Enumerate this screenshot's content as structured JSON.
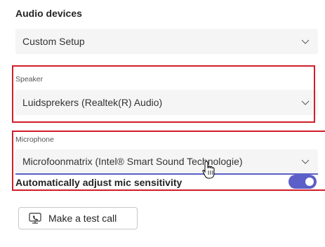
{
  "audio": {
    "section_title": "Audio devices",
    "device_setup": {
      "value": "Custom Setup",
      "icon": "chevron-down-icon"
    },
    "speaker": {
      "label": "Speaker",
      "value": "Luidsprekers (Realtek(R) Audio)",
      "icon": "chevron-down-icon"
    },
    "microphone": {
      "label": "Microphone",
      "value": "Microfoonmatrix (Intel® Smart Sound Technologie)",
      "icon": "chevron-down-icon"
    },
    "auto_adjust": {
      "label": "Automatically adjust mic sensitivity",
      "enabled": true
    },
    "test_call": {
      "label": "Make a test call",
      "icon": "test-call-icon"
    }
  },
  "colors": {
    "accent": "#5b5fc7",
    "highlight": "#d11d2a",
    "dropdown_bg": "#f5f5f5",
    "text": "#242424"
  }
}
